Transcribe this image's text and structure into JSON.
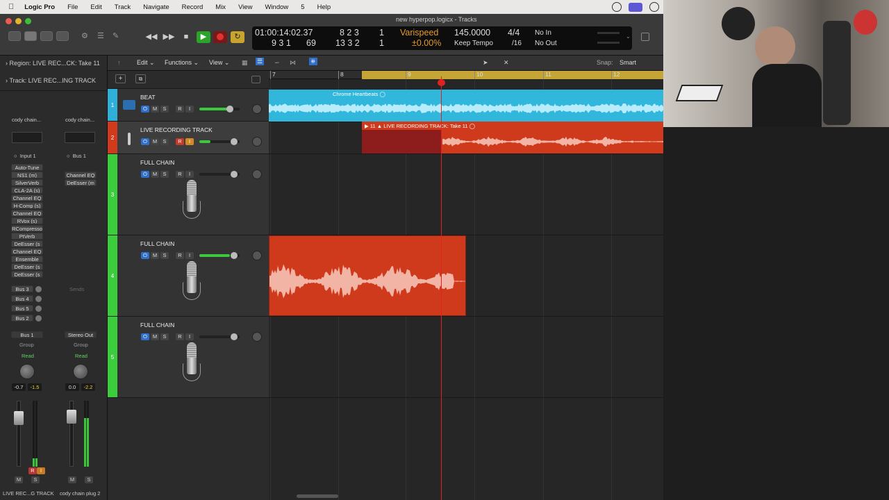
{
  "menubar": {
    "apple": "",
    "app": "Logic Pro",
    "items": [
      "File",
      "Edit",
      "Track",
      "Navigate",
      "Record",
      "Mix",
      "View",
      "Window",
      "5",
      "Help"
    ]
  },
  "window": {
    "title": "new hyperpop.logicx - Tracks"
  },
  "lcd": {
    "time": "01:00:14:02.37",
    "bars_top": "8  2  3",
    "bars_top_sub": "1",
    "bars_bottom": "9  3  1",
    "bars_bottom_sub": "69",
    "bars_bottom_sub2": "13  3  2",
    "bars_bottom_sub3": "1",
    "varispeed": "Varispeed",
    "varispeed_value": "±0.00%",
    "tempo": "145.0000",
    "tempo_label": "Keep Tempo",
    "signature": "4/4",
    "division": "/16",
    "in": "No In",
    "out": "No Out"
  },
  "inspector": {
    "region": "Region:  LIVE REC...CK: Take 11",
    "track": "Track:  LIVE REC...ING TRACK",
    "left_strip": {
      "setting": "cody chain...",
      "input": "Input 1",
      "plugins": [
        "Auto-Tune",
        "NS1 (m)",
        "SilverVerb",
        "CLA-2A (s)",
        "Channel EQ",
        "H-Comp (s)",
        "Channel EQ",
        "RVox (s)",
        "RCompresso",
        "PtVerb",
        "DeEsser (s",
        "Channel EQ",
        "Ensemble",
        "DeEsser (s",
        "DeEsser (s"
      ],
      "sends": [
        "Bus 3",
        "Bus 4",
        "Bus 5",
        "Bus 2"
      ],
      "output": "Bus 1",
      "group": "Group",
      "automation": "Read",
      "val1": "-0.7",
      "val2": "-1.5",
      "m": "M",
      "s": "S",
      "r": "R",
      "i": "I",
      "name": "LIVE REC...G TRACK"
    },
    "right_strip": {
      "setting": "cody chain...",
      "input": "Bus 1",
      "plugins": [
        "Channel EQ",
        "DeEsser (m"
      ],
      "sends_label": "Sends",
      "output": "Stereo Out",
      "group": "Group",
      "automation": "Read",
      "val1": "0.0",
      "val2": "-2.2",
      "m": "M",
      "s": "S",
      "name": "cody chain plug 2"
    }
  },
  "trackbar": {
    "edit": "Edit",
    "functions": "Functions",
    "view": "View",
    "snap_label": "Snap:",
    "snap_value": "Smart"
  },
  "tracks": [
    {
      "num": "1",
      "name": "BEAT",
      "color": "#2fb0d8"
    },
    {
      "num": "2",
      "name": "LIVE RECORDING TRACK",
      "color": "#d13a1c"
    },
    {
      "num": "3",
      "name": "FULL CHAIN",
      "color": "#3ccd3c"
    },
    {
      "num": "4",
      "name": "FULL CHAIN",
      "color": "#3ccd3c"
    },
    {
      "num": "5",
      "name": "FULL CHAIN",
      "color": "#3ccd3c"
    }
  ],
  "track_buttons": {
    "m": "M",
    "s": "S",
    "r": "R",
    "i": "I"
  },
  "ruler": {
    "bars": [
      "7",
      "8",
      "9",
      "10",
      "11",
      "12"
    ]
  },
  "regions": {
    "beat": "Chrome Heartbeats",
    "live": "LIVE RECORDING TRACK: Take 11",
    "live_num": "11"
  },
  "colors": {
    "accent": "#2f6fc9",
    "record": "#d33",
    "play": "#2aa52a",
    "cycle": "#c4a535"
  }
}
